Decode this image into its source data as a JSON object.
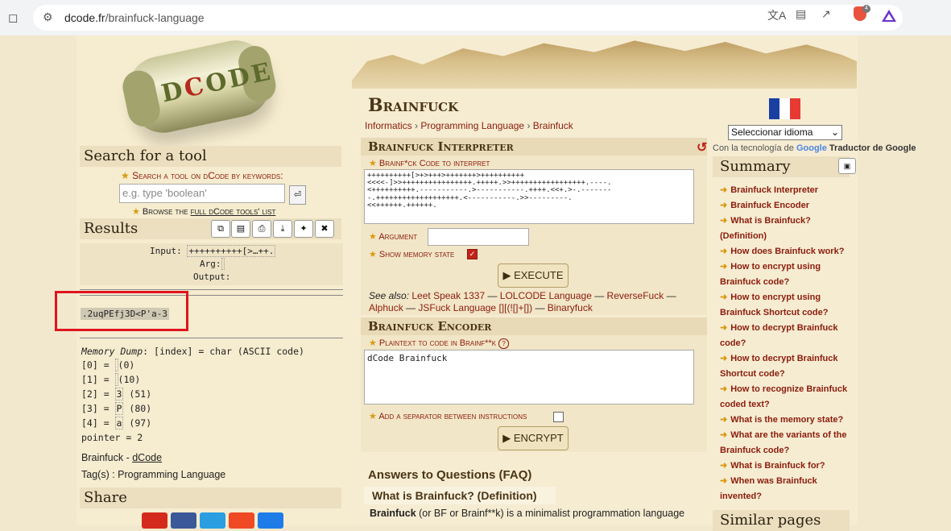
{
  "browser": {
    "url_host": "dcode.fr",
    "url_path": "/brainfuck-language",
    "brave_badge": "4"
  },
  "logo": {
    "letters_left": "D",
    "letters_red": "C",
    "letters_right": "ODE"
  },
  "search": {
    "heading": "Search for a tool",
    "label": "Search a tool on dCode by keywords:",
    "placeholder": "e.g. type 'boolean'",
    "browse_prefix": "Browse the ",
    "browse_link": "full dCode tools' list"
  },
  "results": {
    "heading": "Results",
    "input_label": "Input:",
    "input_value": "++++++++++[>…++.",
    "arg_label": "Arg:",
    "output_label": "Output:",
    "output_value": ".2uqPEfj3D<P'a-3",
    "memory_title": "Memory Dump",
    "memory_format": ": [index] = char (ASCII code)",
    "memory_rows": [
      {
        "idx": "[0] = ",
        "char": " ",
        "code": "(0)"
      },
      {
        "idx": "[1] = ",
        "char": " ",
        "code": "(10)"
      },
      {
        "idx": "[2] = ",
        "char": "3",
        "code": "(51)"
      },
      {
        "idx": "[3] = ",
        "char": "P",
        "code": "(80)"
      },
      {
        "idx": "[4] = ",
        "char": "a",
        "code": "(97)"
      }
    ],
    "pointer": "pointer = 2",
    "footer_prefix": "Brainfuck - ",
    "footer_link": "dCode",
    "tags": "Tag(s) : Programming Language"
  },
  "share": {
    "heading": "Share"
  },
  "main": {
    "title": "Brainfuck",
    "breadcrumb": [
      "Informatics",
      "Programming Language",
      "Brainfuck"
    ],
    "interpreter": {
      "heading": "Brainfuck Interpreter",
      "code_label": "Brainf*ck Code to interpret",
      "code": "++++++++++[>+>+++>+++++++>++++++++++\n<<<<-]>>++++++++++++++++.+++++.>>+++++++++++++++++.----.\n<++++++++++.-----------.>-----------.++++.<<+.>-.-------\n-.+++++++++++++++++++.<-----------.>>---------.\n<<++++++.++++++.",
      "argument_label": "Argument",
      "memory_label": "Show memory state",
      "execute_label": "EXECUTE"
    },
    "see_also": {
      "prefix": "See also: ",
      "links": [
        "Leet Speak 1337",
        "LOLCODE Language",
        "ReverseFuck",
        "Alphuck",
        "JSFuck Language [][(![]+[])",
        "Binaryfuck"
      ]
    },
    "encoder": {
      "heading": "Brainfuck Encoder",
      "plaintext_label": "Plaintext to code in Brainf**k",
      "plaintext_value": "dCode Brainfuck",
      "separator_label": "Add a separator between instructions",
      "encrypt_label": "ENCRYPT"
    },
    "faq": {
      "heading": "Answers to Questions (FAQ)",
      "question": "What is Brainfuck? (Definition)",
      "answer_bold": "Brainfuck",
      "answer_rest": " (or BF or Brainf**k) is a minimalist programmation language"
    }
  },
  "right": {
    "language_select": "Seleccionar idioma",
    "translate_prefix": "Con la tecnología de ",
    "translate_google": "Google",
    "translate_suffix": "Traductor de Google",
    "summary_heading": "Summary",
    "summary_items": [
      "Brainfuck Interpreter",
      "Brainfuck Encoder",
      "What is Brainfuck? (Definition)",
      "How does Brainfuck work?",
      "How to encrypt using Brainfuck code?",
      "How to encrypt using Brainfuck Shortcut code?",
      "How to decrypt Brainfuck code?",
      "How to decrypt Brainfuck Shortcut code?",
      "How to recognize Brainfuck coded text?",
      "What is the memory state?",
      "What are the variants of the Brainfuck code?",
      "What is Brainfuck for?",
      "When was Brainfuck invented?"
    ],
    "similar_heading": "Similar pages"
  },
  "colors": {
    "accent": "#8b1c0c",
    "highlight": "#e0141e",
    "star": "#d99a12"
  }
}
